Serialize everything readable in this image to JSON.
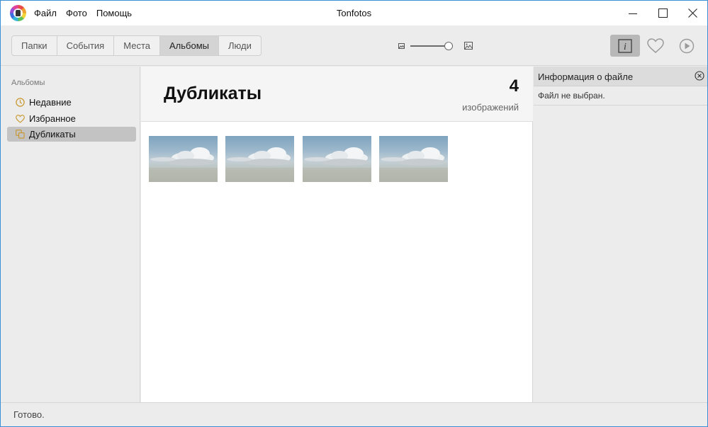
{
  "window": {
    "title": "Tonfotos",
    "menu": [
      "Файл",
      "Фото",
      "Помощь"
    ]
  },
  "toolbar": {
    "tabs": [
      "Папки",
      "События",
      "Места",
      "Альбомы",
      "Люди"
    ],
    "active_tab": "Альбомы",
    "zoom_level": 0.9,
    "info_button_active": true
  },
  "sidebar": {
    "heading": "Альбомы",
    "items": [
      {
        "label": "Недавние",
        "icon": "clock-icon"
      },
      {
        "label": "Избранное",
        "icon": "heart-icon"
      },
      {
        "label": "Дубликаты",
        "icon": "duplicates-icon",
        "active": true
      }
    ]
  },
  "album": {
    "title": "Дубликаты",
    "count": "4",
    "count_label": "изображений",
    "thumbnails": [
      "cloud-photo-1",
      "cloud-photo-2",
      "cloud-photo-3",
      "cloud-photo-4"
    ]
  },
  "info_panel": {
    "title": "Информация о файле",
    "text": "Файл не выбран."
  },
  "status": {
    "text": "Готово."
  },
  "colors": {
    "accent_icon": "#c8962c",
    "window_border": "#3b8fd6",
    "active_segment": "#d4d4d4",
    "active_sidebar": "#c3c3c3"
  }
}
